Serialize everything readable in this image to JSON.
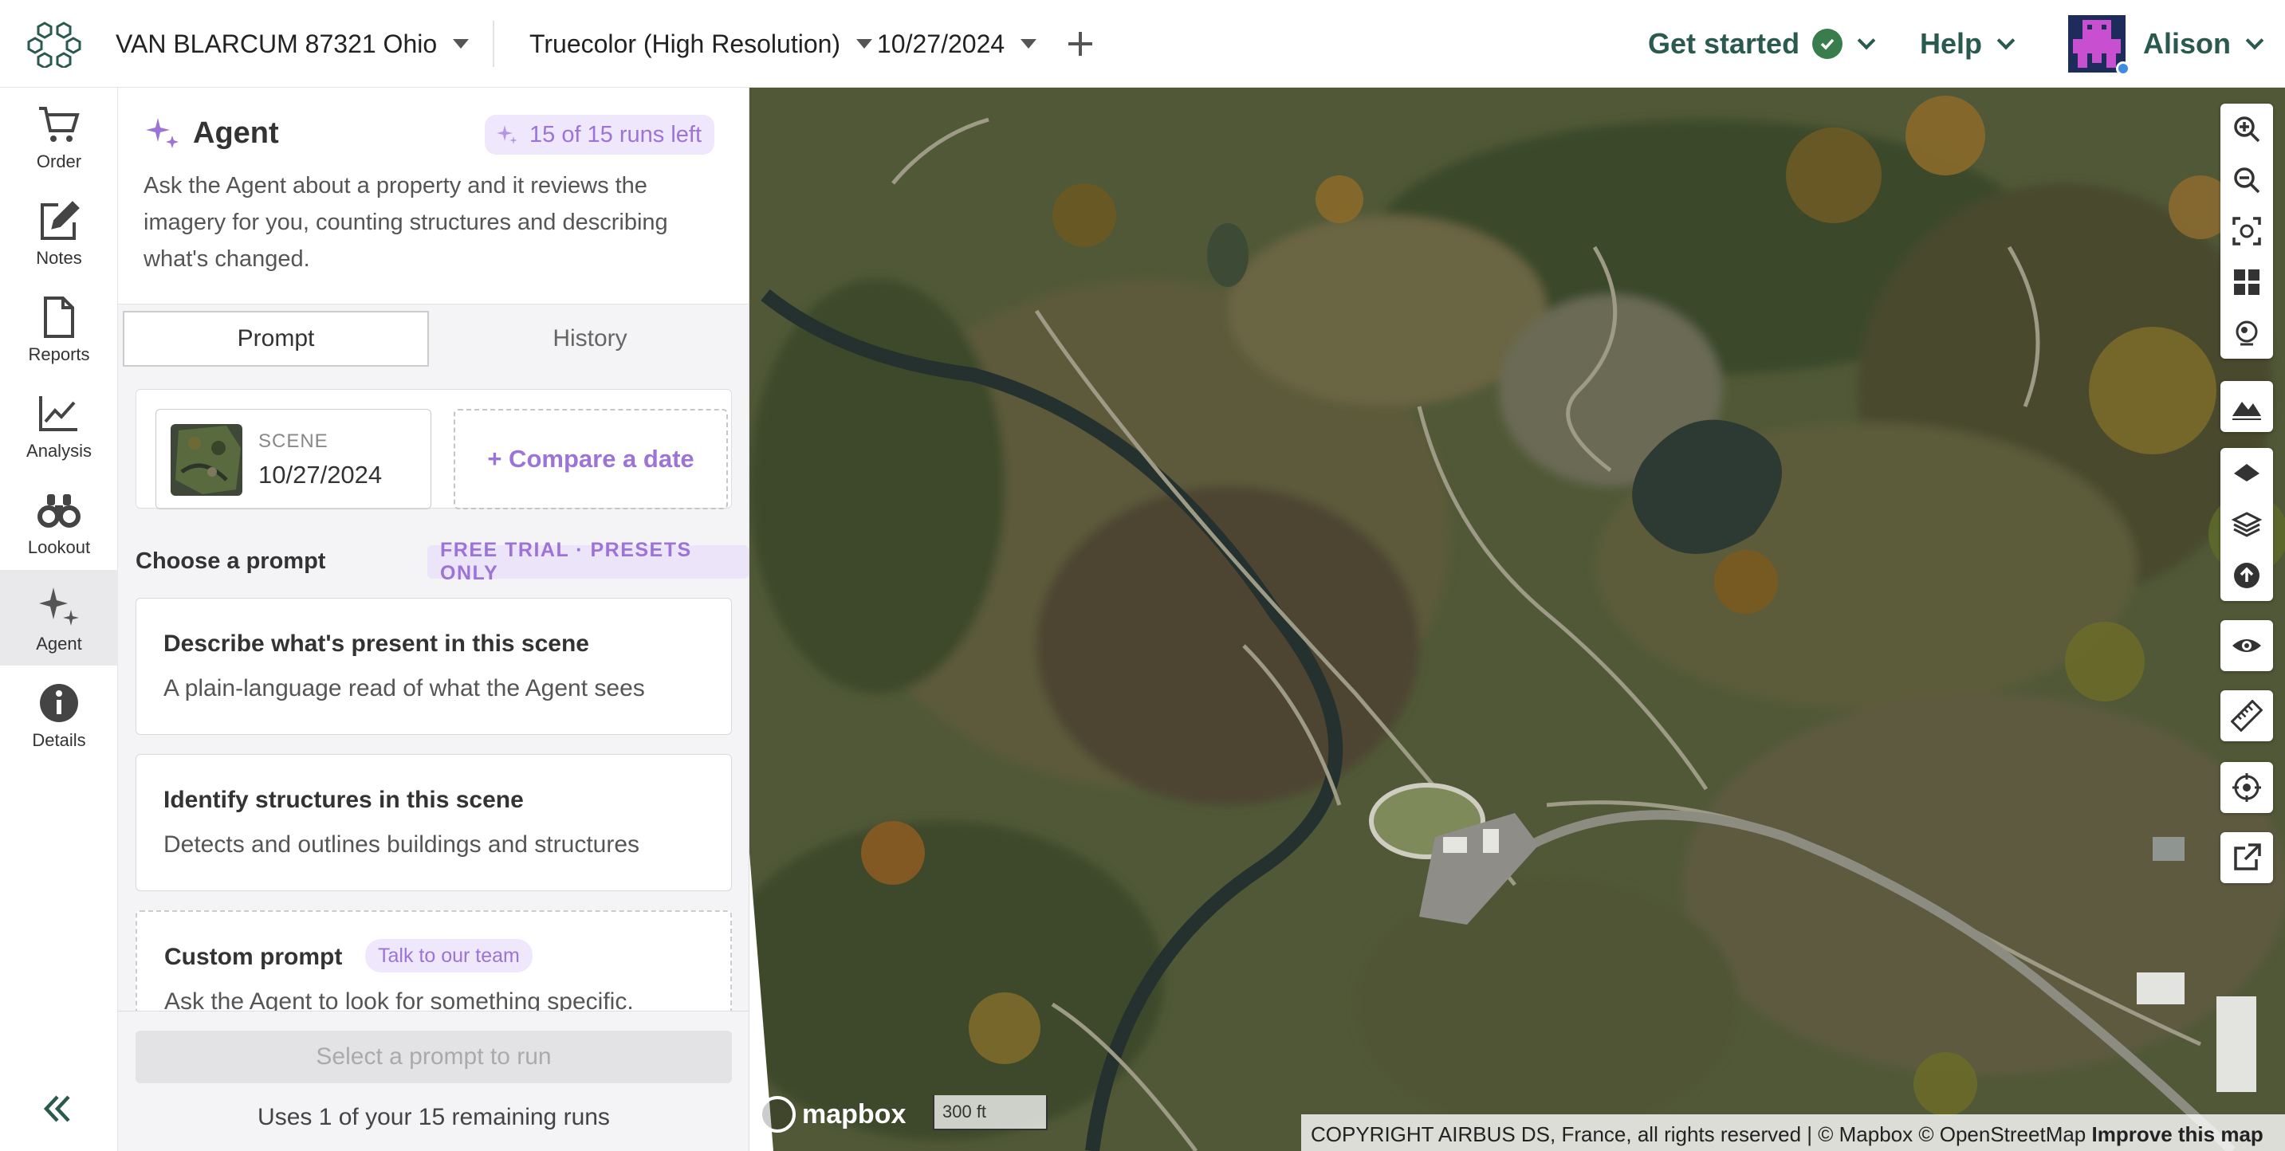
{
  "topbar": {
    "location": "VAN BLARCUM 87321 Ohio",
    "imagery": "Truecolor (High Resolution)",
    "date": "10/27/2024",
    "get_started": "Get started",
    "help": "Help",
    "user": "Alison"
  },
  "rail": {
    "items": [
      {
        "label": "Order",
        "icon": "cart-icon"
      },
      {
        "label": "Notes",
        "icon": "pencil-icon"
      },
      {
        "label": "Reports",
        "icon": "document-icon"
      },
      {
        "label": "Analysis",
        "icon": "chart-line-icon"
      },
      {
        "label": "Lookout",
        "icon": "binoculars-icon"
      },
      {
        "label": "Agent",
        "icon": "sparkle-icon",
        "active": true
      },
      {
        "label": "Details",
        "icon": "info-icon"
      }
    ]
  },
  "agent": {
    "title": "Agent",
    "runs_left": "15 of 15 runs left",
    "description": "Ask the Agent about a property and it reviews the imagery for you, counting structures and describing what's changed.",
    "tabs": [
      "Prompt",
      "History"
    ],
    "scene_label": "SCENE",
    "scene_date": "10/27/2024",
    "compare": "+ Compare a date",
    "choose_label": "Choose a prompt",
    "trial_badge": "FREE TRIAL · PRESETS ONLY",
    "prompts": [
      {
        "title": "Describe what's present in this scene",
        "desc": "A plain-language read of what the Agent sees"
      },
      {
        "title": "Identify structures in this scene",
        "desc": "Detects and outlines buildings and structures"
      }
    ],
    "custom": {
      "title": "Custom prompt",
      "badge": "Talk to our team",
      "desc": "Ask the Agent to look for something specific."
    },
    "run_button": "Select a prompt to run",
    "uses": "Uses 1 of your 15 remaining runs"
  },
  "map": {
    "mapbox": "mapbox",
    "scale": "300 ft",
    "attribution": "COPYRIGHT AIRBUS DS, France, all rights reserved | © Mapbox © OpenStreetMap",
    "improve": "Improve this map",
    "tools": [
      "zoom-in-icon",
      "zoom-out-icon",
      "fit-bounds-icon",
      "grid-icon",
      "search-location-icon",
      "terrain-icon",
      "layer-diamond-icon",
      "layers-icon",
      "upload-icon",
      "eye-icon",
      "ruler-icon",
      "crosshair-icon",
      "external-link-icon"
    ]
  },
  "colors": {
    "accent": "#9b74d6",
    "brand": "#2a5a4d",
    "check": "#3a7d4c"
  }
}
